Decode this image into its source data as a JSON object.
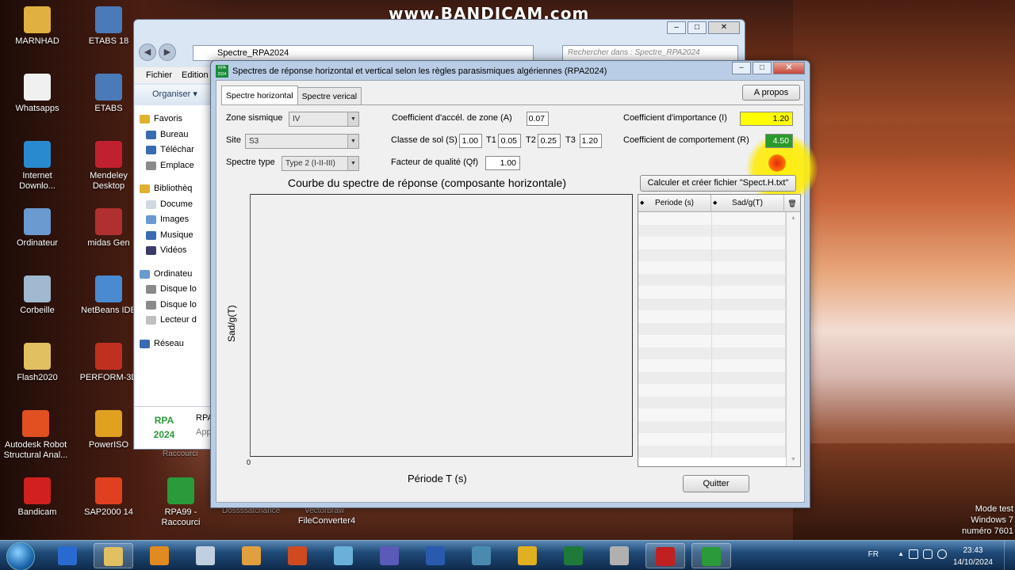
{
  "watermark": "www.BANDICAM.com",
  "desktop_icons": [
    {
      "label": "MARNHAD",
      "color": "#e0b040"
    },
    {
      "label": "ETABS 18",
      "color": "#4a7ab8"
    },
    {
      "label": "Whatsapps",
      "color": "#f0f0f0"
    },
    {
      "label": "ETABS",
      "color": "#4a7ab8"
    },
    {
      "label": "Internet\nDownlo...",
      "color": "#2a8ad0"
    },
    {
      "label": "Mendeley\nDesktop",
      "color": "#c02030"
    },
    {
      "label": "Ordinateur",
      "color": "#6a9ad0"
    },
    {
      "label": "midas Gen",
      "color": "#b03030"
    },
    {
      "label": "Corbeille",
      "color": "#a0b8d0"
    },
    {
      "label": "NetBeans IDE",
      "color": "#4a8ad0"
    },
    {
      "label": "Flash2020",
      "color": "#e0c060"
    },
    {
      "label": "PERFORM-3D",
      "color": "#c03020"
    },
    {
      "label": "Autodesk Robot\nStructural Anal...",
      "color": "#e05020"
    },
    {
      "label": "PowerISO",
      "color": "#e0a020"
    },
    {
      "label": "Bandicam",
      "color": "#d02020"
    },
    {
      "label": "SAP2000 14",
      "color": "#e04020"
    },
    {
      "label": "RPA99 -\nRaccourci",
      "color": "#2a9a3a"
    }
  ],
  "behind_labels": {
    "a": "Raccourci",
    "b": "FileConverter4",
    "c": "Dossssatcnance",
    "d": "Vectorbraw"
  },
  "explorer": {
    "address": "Spectre_RPA2024",
    "search_placeholder": "Rechercher dans : Spectre_RPA2024",
    "menu": [
      "Fichier",
      "Edition"
    ],
    "organize": "Organiser ▾",
    "side": [
      {
        "label": "Favoris",
        "top": true,
        "color": "#e0b030"
      },
      {
        "label": "Bureau",
        "top": false,
        "color": "#3a6ab0"
      },
      {
        "label": "Téléchar",
        "top": false,
        "color": "#3a6ab0"
      },
      {
        "label": "Emplace",
        "top": false,
        "color": "#8a8a8a"
      },
      {
        "gap": true
      },
      {
        "label": "Bibliothèq",
        "top": true,
        "color": "#e0b030"
      },
      {
        "label": "Docume",
        "top": false,
        "color": "#d0d8e0"
      },
      {
        "label": "Images",
        "top": false,
        "color": "#6a9ad0"
      },
      {
        "label": "Musique",
        "top": false,
        "color": "#3a6ab0"
      },
      {
        "label": "Vidéos",
        "top": false,
        "color": "#3a3a6a"
      },
      {
        "gap": true
      },
      {
        "label": "Ordinateu",
        "top": true,
        "color": "#6a9ad0"
      },
      {
        "label": "Disque lo",
        "top": false,
        "color": "#8a8a8a"
      },
      {
        "label": "Disque lo",
        "top": false,
        "color": "#8a8a8a"
      },
      {
        "label": "Lecteur d",
        "top": false,
        "color": "#c0c0c0"
      },
      {
        "gap": true
      },
      {
        "label": "Réseau",
        "top": true,
        "color": "#3a6ab0"
      }
    ],
    "status_logo": "RPA\n2024",
    "status_name": "RPA",
    "status_type": "App"
  },
  "app": {
    "icon_text": "RPA 2024",
    "title": "Spectres de réponse horizontal et vertical selon les règles parasismiques algériennes (RPA2024)",
    "tabs": [
      "Spectre horizontal",
      "Spectre verical"
    ],
    "apropos": "A propos",
    "zone_label": "Zone sismique",
    "zone_value": "IV",
    "site_label": "Site",
    "site_value": "S3",
    "spectre_label": "Spectre type",
    "spectre_value": "Type 2 (I-II-III)",
    "coef_A_label": "Coefficient d'accél. de zone (A)",
    "coef_A": "0.07",
    "classe_label": "Classe de sol (S)",
    "S": "1.00",
    "T1_label": "T1",
    "T1": "0.05",
    "T2_label": "T2",
    "T2": "0.25",
    "T3_label": "T3",
    "T3": "1.20",
    "qf_label": "Facteur de qualité (Qf)",
    "Qf": "1.00",
    "importance_label": "Coefficient d'importance (I)",
    "I": "1.20",
    "comportement_label": "Coefficient de comportement (R)",
    "R": "4.50",
    "calc_button": "Calculer et créer fichier \"Spect.H.txt\"",
    "chart_title": "Courbe du spectre de réponse (composante horizontale)",
    "ylabel": "Sad/g(T)",
    "xlabel": "Période T (s)",
    "x_origin": "0",
    "col1": "Periode (s)",
    "col2": "Sad/g(T)",
    "quit": "Quitter"
  },
  "taskbar": {
    "lang": "FR",
    "time": "23:43",
    "date": "14/10/2024",
    "items": [
      {
        "name": "phone-icon",
        "color": "#2a6ad0",
        "open": false
      },
      {
        "name": "explorer-icon",
        "color": "#e0c060",
        "open": true
      },
      {
        "name": "media-player-icon",
        "color": "#e08a20",
        "open": false
      },
      {
        "name": "calculator-icon",
        "color": "#c0d0e0",
        "open": false
      },
      {
        "name": "paint-icon",
        "color": "#e0a040",
        "open": false
      },
      {
        "name": "powerpoint-icon",
        "color": "#d04a20",
        "open": false
      },
      {
        "name": "notes-icon",
        "color": "#6ab0d8",
        "open": false
      },
      {
        "name": "teams-icon",
        "color": "#5a5ab8",
        "open": false
      },
      {
        "name": "word-icon",
        "color": "#2a5ab0",
        "open": false
      },
      {
        "name": "tool-icon",
        "color": "#4a8ab0",
        "open": false
      },
      {
        "name": "chrome-icon",
        "color": "#e0b020",
        "open": false
      },
      {
        "name": "excel-icon",
        "color": "#1f7a3a",
        "open": false
      },
      {
        "name": "pen-icon",
        "color": "#b0b0b0",
        "open": false
      },
      {
        "name": "bandicam-icon",
        "color": "#c02020",
        "open": true
      },
      {
        "name": "rpa-icon",
        "color": "#2a9a3a",
        "open": true
      }
    ]
  },
  "mode_text": "Mode test\nWindows 7\nnuméro 7601"
}
